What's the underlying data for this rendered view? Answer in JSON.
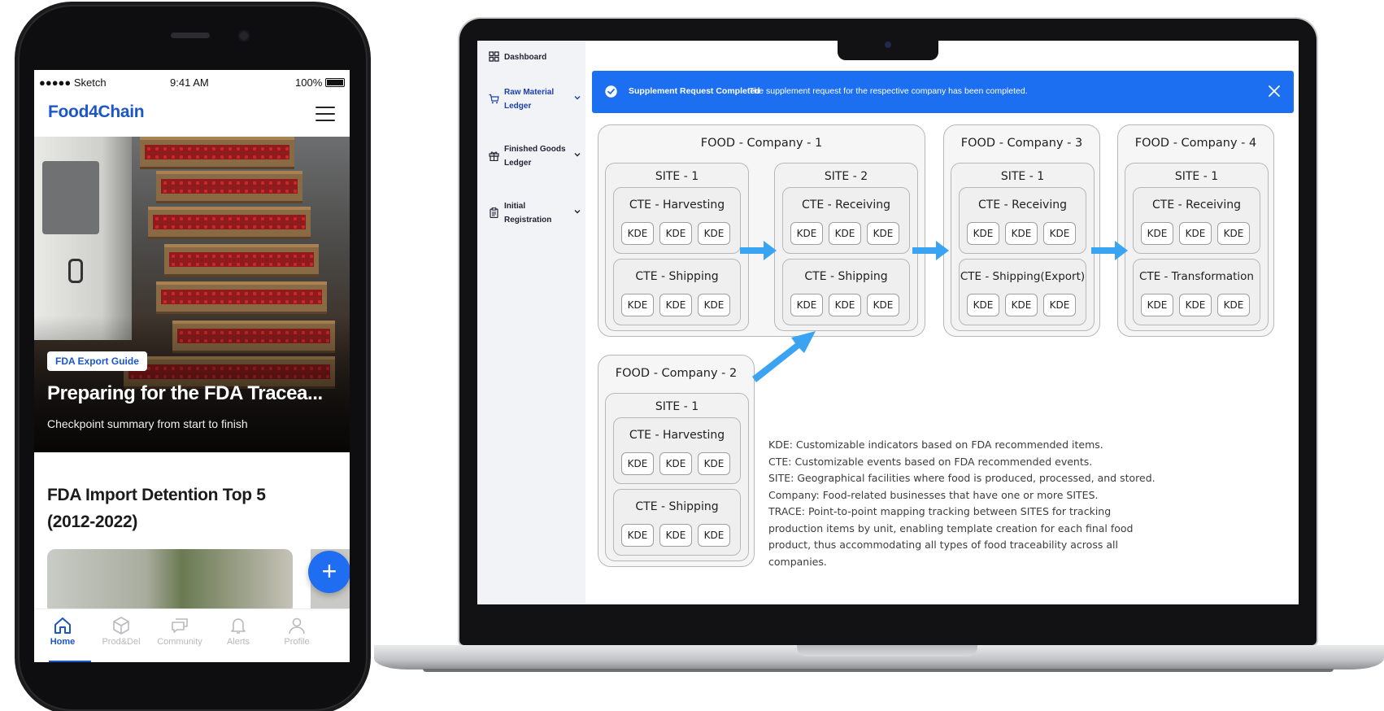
{
  "colors": {
    "brand": "#1c56c9",
    "alert_bg": "#1d6ff2",
    "arrow": "#3aa3f2",
    "fab": "#1f6df0"
  },
  "phone": {
    "status": {
      "carrier": "●●●●● Sketch",
      "time": "9:41 AM",
      "battery": "100%"
    },
    "app_name": "Food4Chain",
    "menu_icon": "hamburger-icon",
    "hero": {
      "badge": "FDA Export Guide",
      "title": "Preparing for the FDA Tracea...",
      "subtitle": "Checkpoint summary from start to finish"
    },
    "section_title": "FDA Import Detention Top 5 (2012-2022)",
    "fab_label": "+",
    "tabs": [
      {
        "label": "Home",
        "icon": "home-icon",
        "active": true
      },
      {
        "label": "Prod&Del",
        "icon": "box-icon",
        "active": false
      },
      {
        "label": "Community",
        "icon": "chat-icon",
        "active": false
      },
      {
        "label": "Alerts",
        "icon": "bell-icon",
        "active": false
      },
      {
        "label": "Profile",
        "icon": "user-icon",
        "active": false
      }
    ]
  },
  "laptop": {
    "sidebar": [
      {
        "label": "Dashboard",
        "icon": "grid-icon",
        "expandable": false,
        "active": false
      },
      {
        "label": "Raw Material Ledger",
        "icon": "cart-icon",
        "expandable": true,
        "active": true
      },
      {
        "label": "Finished Goods Ledger",
        "icon": "gift-icon",
        "expandable": true,
        "active": false
      },
      {
        "label": "Initial Registration",
        "icon": "clipboard-icon",
        "expandable": true,
        "active": false
      }
    ],
    "alert": {
      "title": "Supplement Request Completed",
      "message": "The supplement request for the respective company has been completed."
    },
    "diagram": {
      "kde_label": "KDE",
      "companies": [
        {
          "name": "FOOD - Company - 1",
          "sites": [
            {
              "name": "SITE - 1",
              "ctes": [
                "CTE - Harvesting",
                "CTE - Shipping"
              ]
            },
            {
              "name": "SITE - 2",
              "ctes": [
                "CTE - Receiving",
                "CTE - Shipping"
              ]
            }
          ]
        },
        {
          "name": "FOOD - Company - 3",
          "sites": [
            {
              "name": "SITE - 1",
              "ctes": [
                "CTE - Receiving",
                "CTE - Shipping(Export)"
              ]
            }
          ]
        },
        {
          "name": "FOOD - Company - 4",
          "sites": [
            {
              "name": "SITE - 1",
              "ctes": [
                "CTE - Receiving",
                "CTE - Transformation"
              ]
            }
          ]
        },
        {
          "name": "FOOD - Company - 2",
          "sites": [
            {
              "name": "SITE - 1",
              "ctes": [
                "CTE - Harvesting",
                "CTE - Shipping"
              ]
            }
          ]
        }
      ],
      "legend": [
        "KDE: Customizable indicators based on FDA recommended items.",
        "CTE: Customizable events based on FDA recommended events.",
        "SITE: Geographical facilities where food is produced, processed, and stored.",
        "Company: Food-related businesses that have one or more SITES.",
        "TRACE: Point-to-point mapping tracking between SITES for tracking production items by unit, enabling template creation for each final food product, thus accommodating all types of food traceability across all companies."
      ]
    }
  }
}
